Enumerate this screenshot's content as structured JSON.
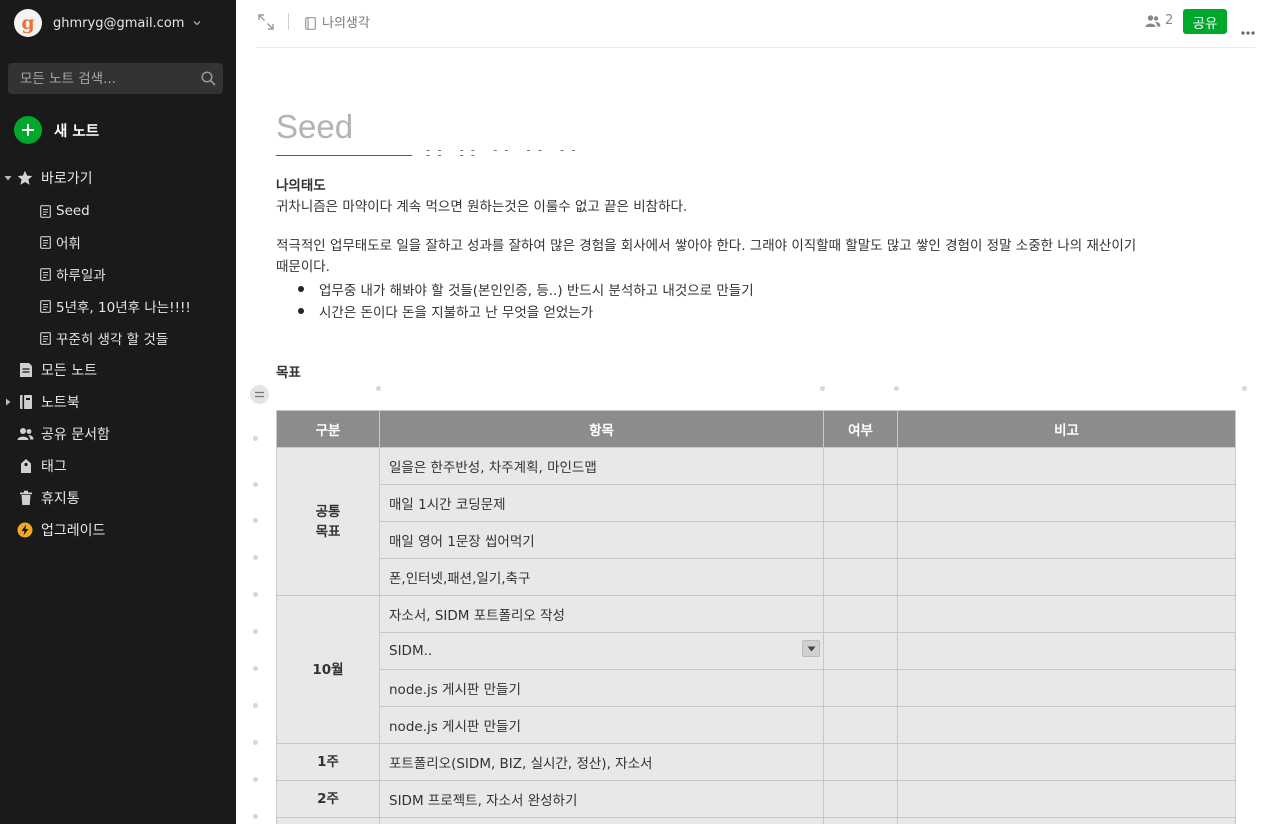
{
  "account": {
    "avatar_letter": "g",
    "email": "ghmryg@gmail.com"
  },
  "search": {
    "placeholder": "모든 노트 검색..."
  },
  "new_note": {
    "label": "새 노트"
  },
  "sidebar": {
    "shortcuts_label": "바로가기",
    "shortcuts": [
      "Seed",
      "어휘",
      "하루일과",
      "5년후, 10년후 나는!!!!",
      "꾸준히 생각 할 것들"
    ],
    "items": [
      {
        "label": "모든 노트",
        "icon": "note-icon"
      },
      {
        "label": "노트북",
        "icon": "notebook-icon"
      },
      {
        "label": "공유 문서함",
        "icon": "people-icon"
      },
      {
        "label": "태그",
        "icon": "tag-icon"
      },
      {
        "label": "휴지통",
        "icon": "trash-icon"
      },
      {
        "label": "업그레이드",
        "icon": "upgrade-icon"
      }
    ]
  },
  "topbar": {
    "notebook_name": "나의생각",
    "share_count": "2",
    "share_label": "공유"
  },
  "note": {
    "title": "Seed",
    "attitude_heading": "나의태도",
    "attitude_line": "귀차니즘은 마약이다 계속 먹으면 원하는것은 이룰수 없고 끝은 비참하다.",
    "paragraph_line1": "적극적인 업무태도로 일을 잘하고 성과를 잘하여 많은 경험을 회사에서 쌓아야 한다. 그래야 이직할때 할말도 많고 쌓인 경험이 정말 소중한 나의 재산이기",
    "paragraph_line2": "때문이다.",
    "bullets": [
      "업무중 내가 해봐야 할 것들(본인인증, 등..) 반드시 분석하고 내것으로 만들기",
      "시간은 돈이다 돈을 지불하고 난 무엇을 얻었는가"
    ],
    "goals_heading": "목표"
  },
  "table": {
    "headers": [
      "구분",
      "항목",
      "여부",
      "비고"
    ],
    "group_common": "공통\n목표",
    "group_october": "10월",
    "week1": "1주",
    "week2": "2주",
    "common_items": [
      "일을은 한주반성, 차주계획, 마인드맵",
      "매일 1시간 코딩문제",
      "매일 영어 1문장 씹어먹기",
      "폰,인터넷,패션,일기,축구"
    ],
    "october_items": [
      "자소서, SIDM 포트폴리오 작성",
      "SIDM..",
      "node.js 게시판 만들기",
      "node.js 게시판 만들기"
    ],
    "week1_item": "포트폴리오(SIDM, BIZ, 실시간, 정산), 자소서",
    "week2_item": "SIDM 프로젝트, 자소서 완성하기"
  }
}
